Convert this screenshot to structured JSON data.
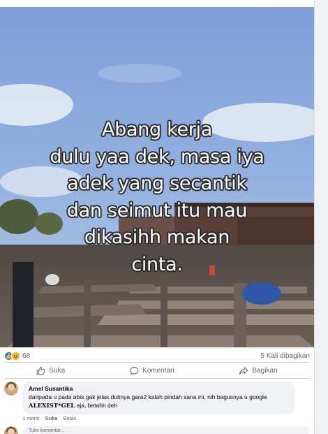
{
  "post": {
    "overlay_lines": [
      "Abang kerja",
      "dulu yaa dek, masa iya",
      "adek yang secantik",
      "dan seimut itu mau",
      "dikasihh makan",
      "cinta."
    ],
    "reaction_count": "68",
    "shares": "5 Kali dibagikan",
    "reaction_icons": [
      "like-icon",
      "haha-icon"
    ]
  },
  "actions": {
    "like": "Suka",
    "comment": "Komentari",
    "share": "Bagikan"
  },
  "comments": [
    {
      "author": "Amel Susantika",
      "text_before": "daripada u pada abis gak jelas duitnya gara2 kalah pindah sana ini, nih bagusnya u google ",
      "brand": "ALEXIST*GEL",
      "text_after": " aja, betahh deh",
      "time": "1 menit",
      "like": "Suka",
      "reply": "Balas"
    }
  ],
  "next_comment_preview": "Tulis komentar..."
}
